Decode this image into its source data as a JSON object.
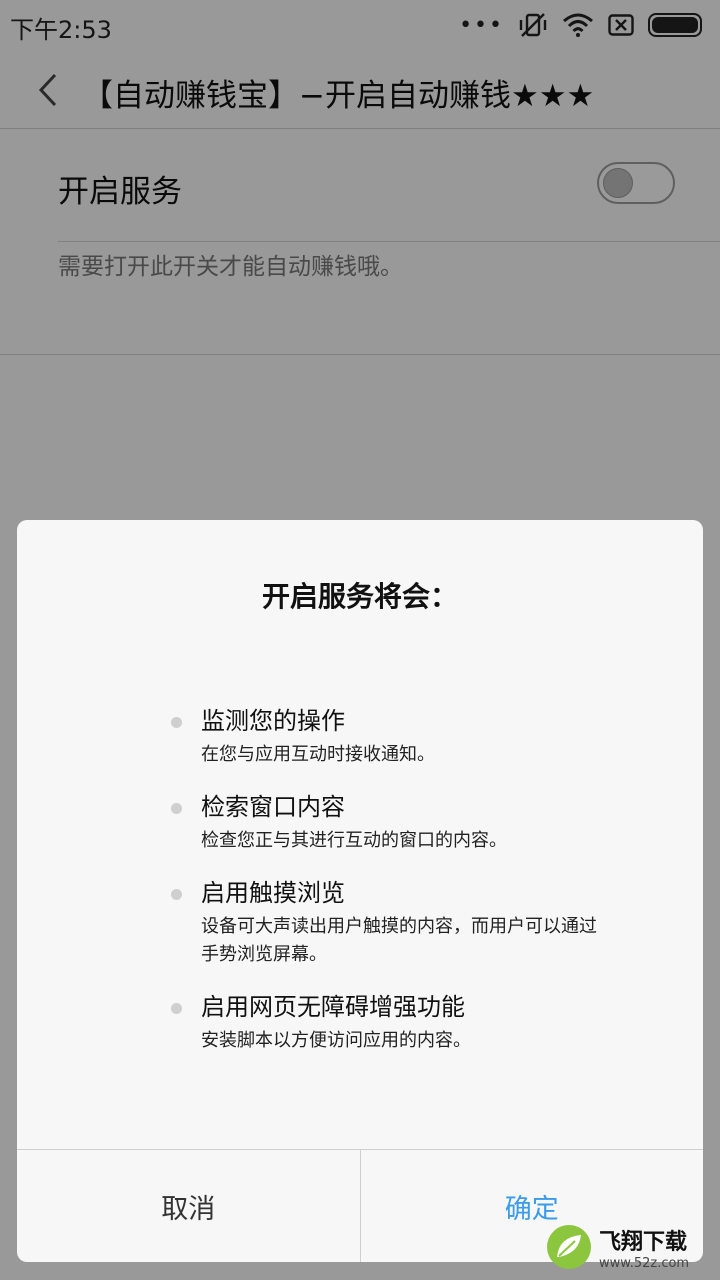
{
  "status_bar": {
    "time": "下午2:53",
    "dots": "•••"
  },
  "header": {
    "title": "【自动赚钱宝】−开启自动赚钱★★★"
  },
  "settings": {
    "service_label": "开启服务",
    "service_toggle_on": false,
    "service_description": "需要打开此开关才能自动赚钱哦。"
  },
  "dialog": {
    "title": "开启服务将会：",
    "items": [
      {
        "title": "监测您的操作",
        "desc": "在您与应用互动时接收通知。"
      },
      {
        "title": "检索窗口内容",
        "desc": "检查您正与其进行互动的窗口的内容。"
      },
      {
        "title": "启用触摸浏览",
        "desc": "设备可大声读出用户触摸的内容，而用户可以通过手势浏览屏幕。"
      },
      {
        "title": "启用网页无障碍增强功能",
        "desc": "安装脚本以方便访问应用的内容。"
      }
    ],
    "cancel_label": "取消",
    "ok_label": "确定"
  },
  "watermark": {
    "main": "飞翔下载",
    "sub": "www.52z.com"
  },
  "colors": {
    "accent": "#3a9be8",
    "overlay": "rgba(0,0,0,0.38)"
  }
}
